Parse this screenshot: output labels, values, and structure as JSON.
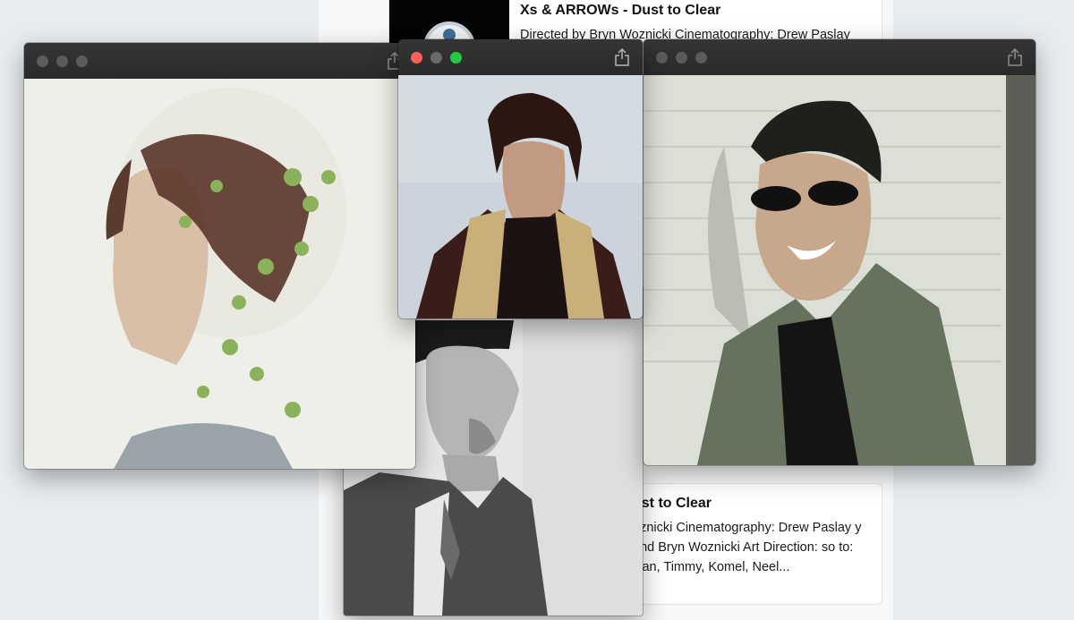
{
  "page": {
    "top_card": {
      "title": "Xs & ARROWs - Dust to Clear",
      "description": "Directed by Bryn Woznicki Cinematography: Drew Paslay"
    },
    "bottom_card": {
      "title": "ust to Clear",
      "description": "oznicki Cinematography: Drew Paslay y and Bryn Woznicki Art Direction: so to: Dan, Timmy, Komel, Neel..."
    }
  },
  "windows": [
    {
      "id": "left",
      "image": "double-exposure portrait of woman with leaves",
      "active": false
    },
    {
      "id": "middle",
      "image": "young man with curly hair wearing scarf",
      "active": true
    },
    {
      "id": "right",
      "image": "smiling man with sunglasses in jacket",
      "active": false
    },
    {
      "id": "bottom",
      "image": "black and white portrait of man in beanie and denim jacket",
      "active": false
    }
  ],
  "icons": {
    "share": "share-icon",
    "traffic_lights": [
      "close-button",
      "minimize-button",
      "zoom-button"
    ]
  },
  "colors": {
    "titlebar": "#2e2e2e",
    "close": "#fe5f57",
    "zoom": "#28c840",
    "inactive_light": "#5b5b5b",
    "background": "#e9ecef"
  }
}
